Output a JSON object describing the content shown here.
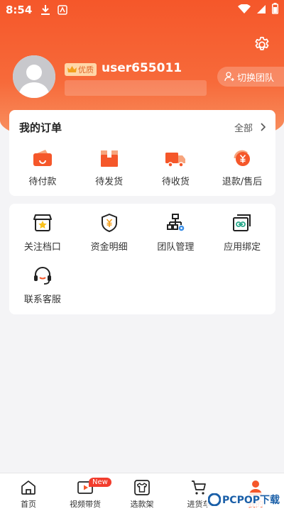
{
  "status_bar": {
    "time": "8:54"
  },
  "profile": {
    "badge": "优质",
    "username": "user655011",
    "switch_team": "切换团队"
  },
  "orders": {
    "title": "我的订单",
    "all": "全部",
    "items": [
      {
        "label": "待付款",
        "icon": "wallet-icon"
      },
      {
        "label": "待发货",
        "icon": "package-icon"
      },
      {
        "label": "待收货",
        "icon": "truck-icon"
      },
      {
        "label": "退款/售后",
        "icon": "refund-icon"
      }
    ]
  },
  "services": {
    "items": [
      {
        "label": "关注档口",
        "icon": "star-shop-icon"
      },
      {
        "label": "资金明细",
        "icon": "shield-yuan-icon"
      },
      {
        "label": "团队管理",
        "icon": "org-chart-icon"
      },
      {
        "label": "应用绑定",
        "icon": "link-card-icon"
      },
      {
        "label": "联系客服",
        "icon": "headset-icon"
      }
    ]
  },
  "tabbar": {
    "items": [
      {
        "label": "首页",
        "icon": "home-icon"
      },
      {
        "label": "视频带货",
        "icon": "video-icon",
        "badge": "New"
      },
      {
        "label": "选款架",
        "icon": "shirt-icon"
      },
      {
        "label": "进货车",
        "icon": "cart-icon"
      },
      {
        "label": "我的",
        "icon": "person-icon",
        "active": true
      }
    ]
  },
  "watermark": "PCPOP下载",
  "colors": {
    "accent": "#f5572a",
    "badge_bg": "#ffd7a8",
    "page_bg": "#f4f4f6"
  }
}
